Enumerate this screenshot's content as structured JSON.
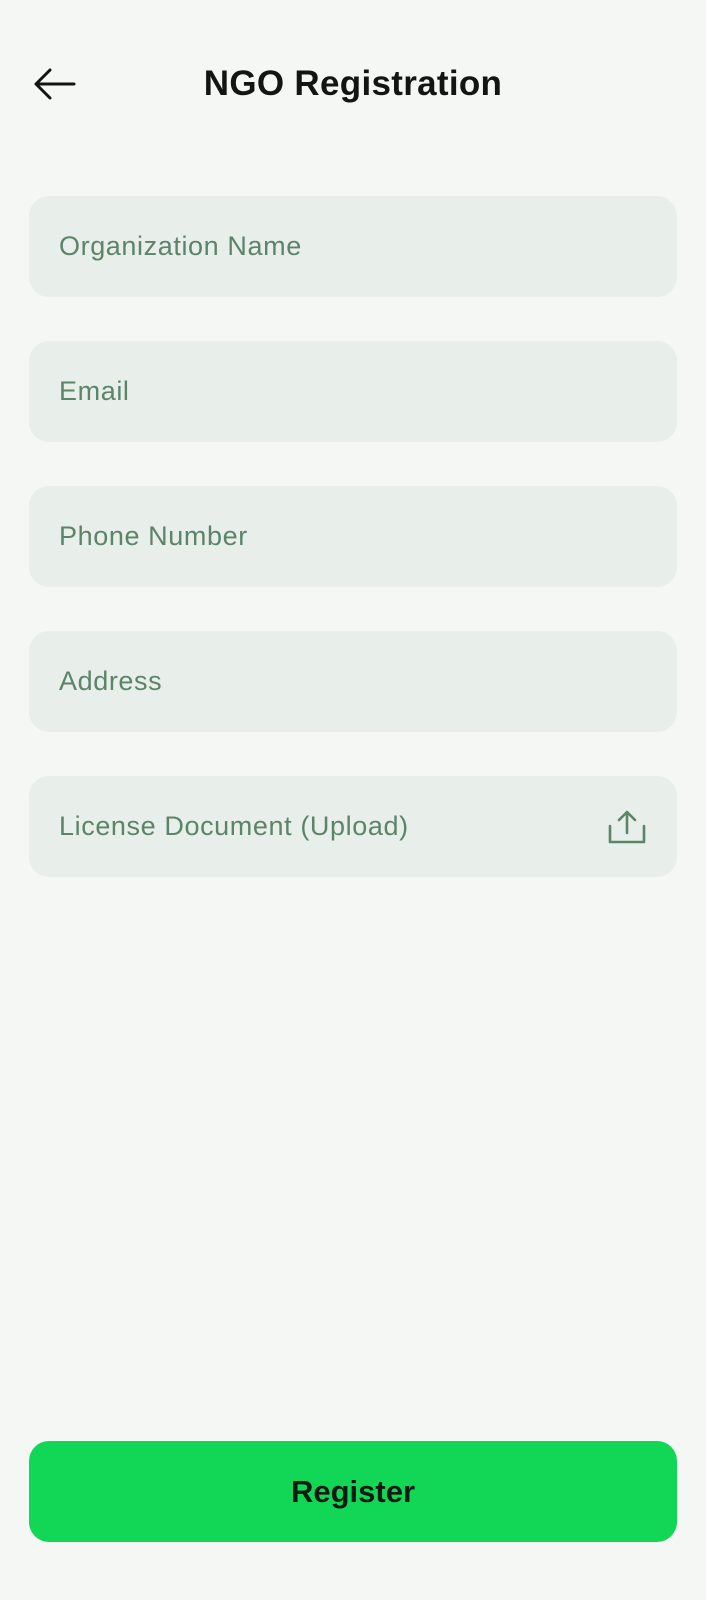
{
  "header": {
    "title": "NGO Registration",
    "back_icon": "arrow-left-icon"
  },
  "form": {
    "organization_name": {
      "placeholder": "Organization Name",
      "value": ""
    },
    "email": {
      "placeholder": "Email",
      "value": ""
    },
    "phone_number": {
      "placeholder": "Phone Number",
      "value": ""
    },
    "address": {
      "placeholder": "Address",
      "value": ""
    },
    "license_document": {
      "label": "License Document (Upload)",
      "icon": "upload-icon"
    }
  },
  "actions": {
    "register_label": "Register"
  },
  "colors": {
    "background": "#f5f7f4",
    "field_background": "#e8eee9",
    "placeholder_text": "#5b8468",
    "primary_button": "#12d656",
    "title_text": "#111612"
  }
}
